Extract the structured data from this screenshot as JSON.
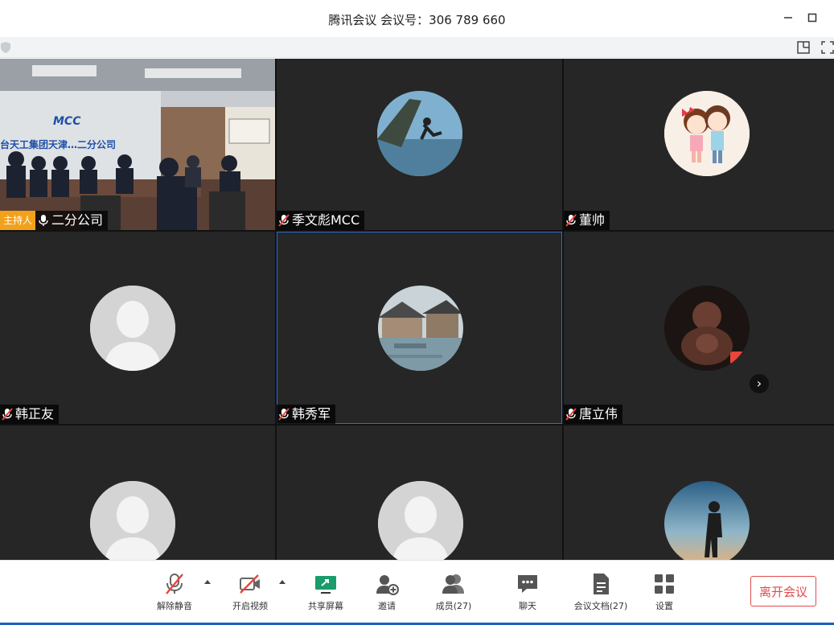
{
  "window": {
    "title": "腾讯会议 会议号：306 789 660"
  },
  "participants": [
    {
      "name": "二分公司",
      "host_badge": "主持人",
      "muted": false,
      "video": true
    },
    {
      "name": "季文彪MCC",
      "muted": true,
      "avatar": "photo-cliff-jump"
    },
    {
      "name": "董帅",
      "muted": true,
      "avatar": "cartoon-couple"
    },
    {
      "name": "韩正友",
      "muted": true,
      "avatar": "default-person"
    },
    {
      "name": "韩秀军",
      "muted": true,
      "avatar": "photo-courtyard",
      "speaking": true
    },
    {
      "name": "唐立伟",
      "muted": true,
      "avatar": "photo-buddha-statue"
    },
    {
      "avatar": "default-person"
    },
    {
      "avatar": "default-person"
    },
    {
      "avatar": "photo-silhouette-sunset"
    }
  ],
  "video_feed": {
    "banner_text": "台天工集团天津…二分公司",
    "logo_text": "MCC"
  },
  "toolbar": {
    "unmute": "解除静音",
    "start_video": "开启视频",
    "share_screen": "共享屏幕",
    "invite": "邀请",
    "members": "成员(27)",
    "chat": "聊天",
    "documents": "会议文档(27)",
    "settings": "设置",
    "leave": "离开会议"
  },
  "colors": {
    "host_badge": "#f3a01b",
    "leave": "#e04b4b",
    "share_icon": "#1a9c6b",
    "speaking_border": "#2d6be0"
  },
  "icons": {
    "next_page": "chevron-right-icon",
    "window_min": "minimize-icon",
    "window_max": "maximize-icon"
  }
}
